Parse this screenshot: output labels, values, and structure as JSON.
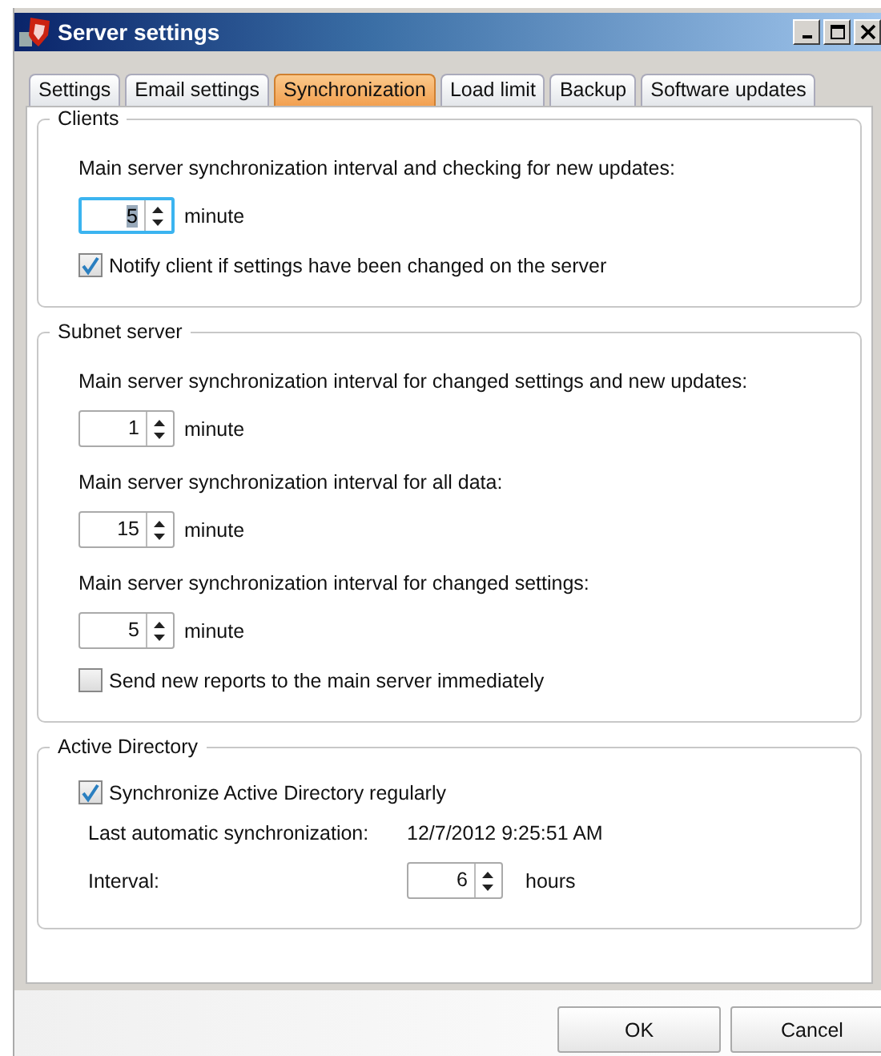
{
  "window": {
    "title": "Server settings"
  },
  "tabs": [
    {
      "label": "Settings",
      "selected": false
    },
    {
      "label": "Email settings",
      "selected": false
    },
    {
      "label": "Synchronization",
      "selected": true
    },
    {
      "label": "Load limit",
      "selected": false
    },
    {
      "label": "Backup",
      "selected": false
    },
    {
      "label": "Software updates",
      "selected": false
    }
  ],
  "groups": [
    {
      "title": "Clients",
      "items": [
        {
          "kind": "label",
          "text": "Main server synchronization interval and checking for new updates:"
        },
        {
          "kind": "spinner",
          "value": "5",
          "unit": "minute",
          "focused": true
        },
        {
          "kind": "checkbox",
          "label": "Notify client if settings have been changed on the server",
          "checked": true
        }
      ]
    },
    {
      "title": "Subnet server",
      "items": [
        {
          "kind": "label",
          "text": "Main server synchronization interval for changed settings and new updates:"
        },
        {
          "kind": "spinner",
          "value": "1",
          "unit": "minute",
          "focused": false
        },
        {
          "kind": "label",
          "text": "Main server synchronization interval for all data:"
        },
        {
          "kind": "spinner",
          "value": "15",
          "unit": "minute",
          "focused": false
        },
        {
          "kind": "label",
          "text": "Main server synchronization interval for changed settings:"
        },
        {
          "kind": "spinner",
          "value": "5",
          "unit": "minute",
          "focused": false
        },
        {
          "kind": "checkbox",
          "label": "Send new reports to the main server immediately",
          "checked": false
        }
      ]
    },
    {
      "title": "Active Directory",
      "items": [
        {
          "kind": "checkbox",
          "label": "Synchronize Active Directory regularly",
          "checked": true
        },
        {
          "kind": "info",
          "label": "Last automatic synchronization:",
          "value": "12/7/2012 9:25:51 AM"
        },
        {
          "kind": "spinner",
          "label": "Interval:",
          "value": "6",
          "unit": "hours",
          "focused": false
        }
      ]
    }
  ],
  "buttons": [
    "OK",
    "Cancel"
  ]
}
